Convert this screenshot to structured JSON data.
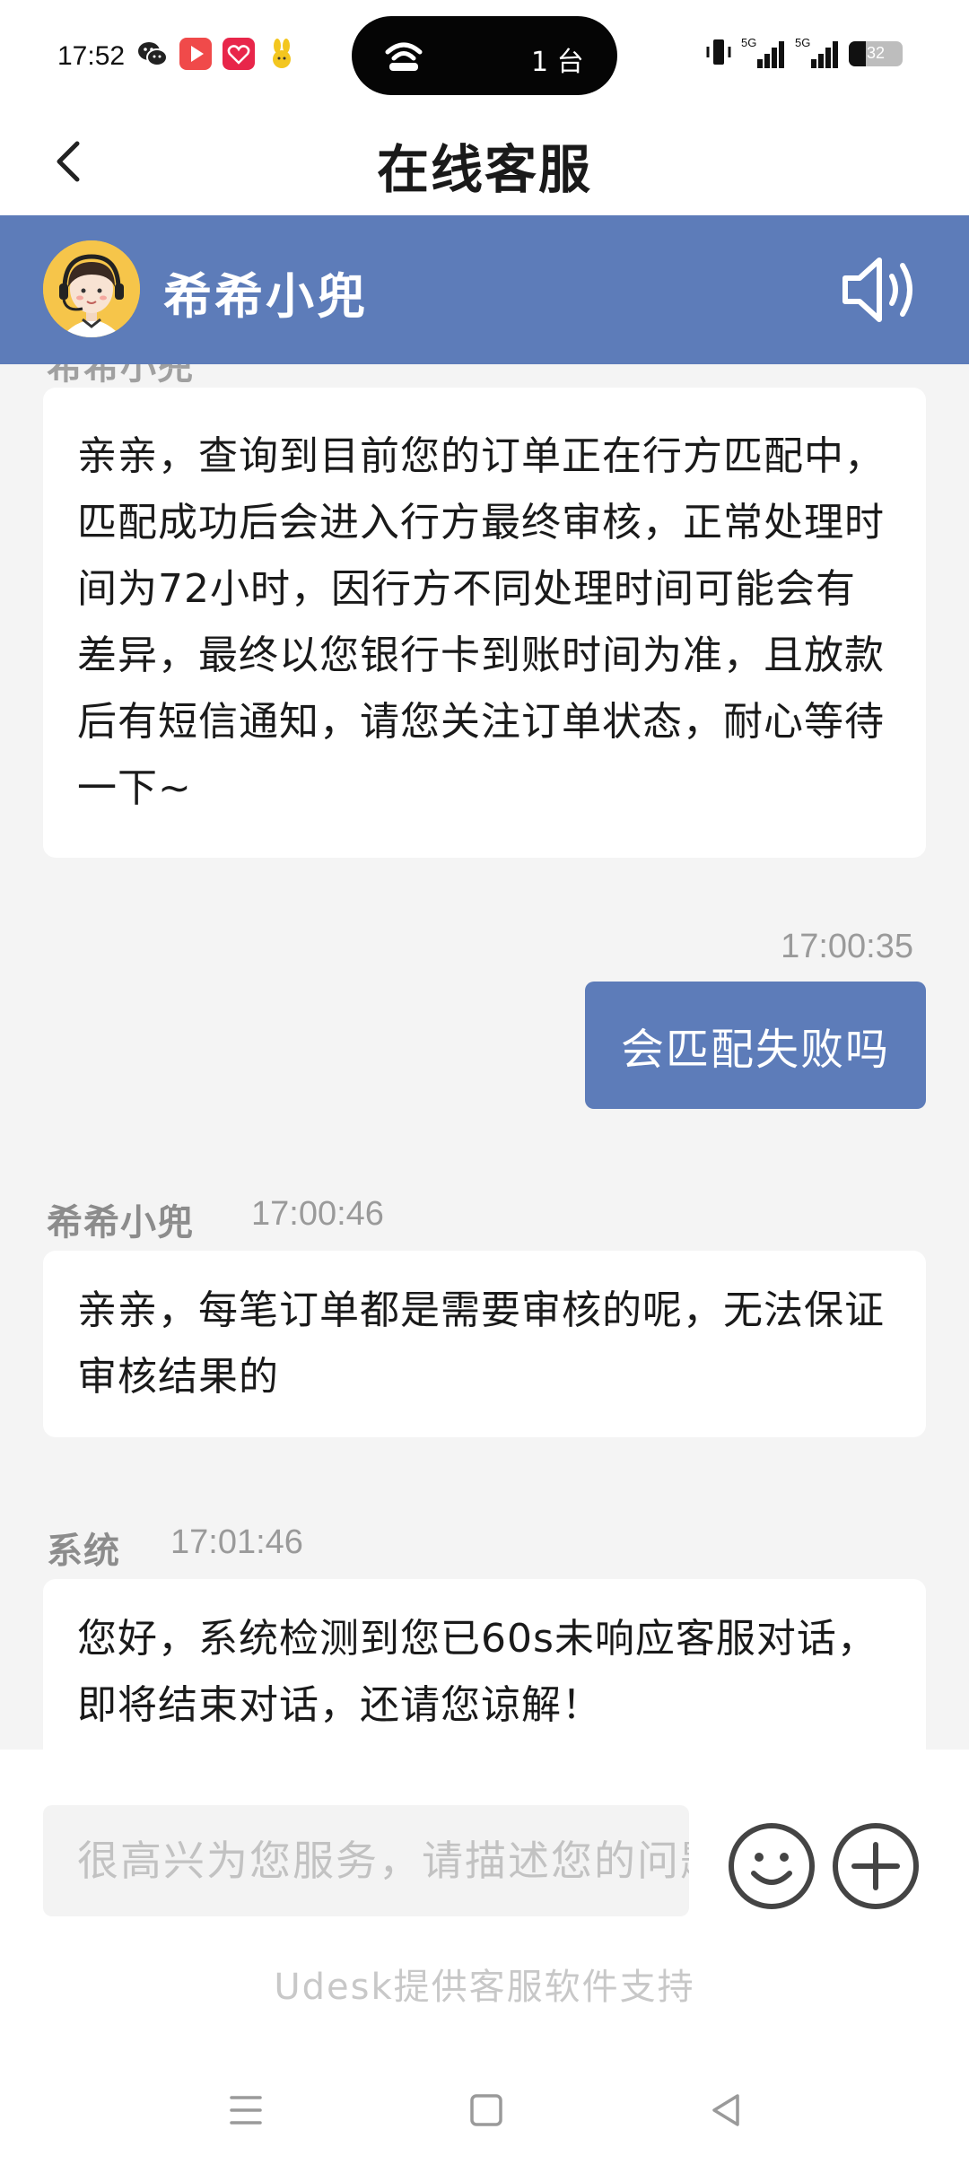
{
  "status_bar": {
    "time": "17:52",
    "island_text": "1 台",
    "network_label_1": "5G",
    "network_label_2": "5G",
    "battery_level": 32,
    "battery_text": "32",
    "app_icons": [
      "wechat-icon",
      "video-app-icon",
      "red-app-icon",
      "yellow-rabbit-app-icon"
    ]
  },
  "header": {
    "title": "在线客服",
    "back_icon": "chevron-left-icon"
  },
  "agent": {
    "name": "希希小兜",
    "avatar_icon": "support-agent-avatar",
    "speaker_icon": "speaker-icon",
    "accent_color": "#5d7cb9"
  },
  "messages": [
    {
      "side": "left",
      "text": "亲亲，查询到目前您的订单正在行方匹配中，匹配成功后会进入行方最终审核，正常处理时间为72小时，因行方不同处理时间可能会有差异，最终以您银行卡到账时间为准，且放款后有短信通知，请您关注订单状态，耐心等待一下~"
    },
    {
      "side": "right",
      "time": "17:00:35",
      "text": "会匹配失败吗"
    },
    {
      "side": "left",
      "sender": "希希小兜",
      "time": "17:00:46",
      "text": "亲亲，每笔订单都是需要审核的呢，无法保证审核结果的"
    },
    {
      "side": "left",
      "sender": "系统",
      "time": "17:01:46",
      "text": "您好，系统检测到您已60s未响应客服对话，即将结束对话，还请您谅解！"
    }
  ],
  "input": {
    "placeholder": "很高兴为您服务，请描述您的问题",
    "emoji_icon": "emoji-icon",
    "plus_icon": "plus-circle-icon"
  },
  "footer": {
    "powered_by": "Udesk提供客服软件支持"
  },
  "system_nav": [
    "menu-icon",
    "home-square-icon",
    "back-triangle-icon"
  ]
}
